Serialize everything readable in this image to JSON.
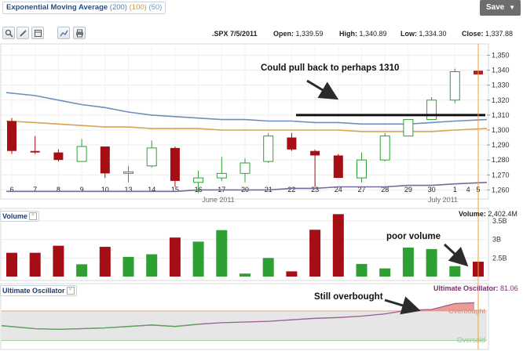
{
  "toolbar": {
    "ema_label": "Exponential Moving Average",
    "ema_periods": [
      "(200)",
      "(100)",
      "(50)"
    ],
    "save_label": "Save"
  },
  "quote": {
    "symbol_date": ".SPX 7/5/2011",
    "open_label": "Open:",
    "open": "1,339.59",
    "high_label": "High:",
    "high": "1,340.89",
    "low_label": "Low:",
    "low": "1,334.30",
    "close_label": "Close:",
    "close": "1,337.88"
  },
  "colors": {
    "up": "#2ea033",
    "down": "#a50e14",
    "ema200": "#6f8fb8",
    "ema100": "#d8a450",
    "ema50": "#7a6a9c",
    "oscillator": "#9c5c92",
    "today_marker": "#f2a23a"
  },
  "volume_panel": {
    "label": "Volume",
    "readout_label": "Volume:",
    "readout_value": "2,402.4M"
  },
  "oscillator_panel": {
    "label": "Ultimate Oscillator",
    "readout_label": "Ultimate Oscillator:",
    "readout_value": "81.06"
  },
  "chart_data": [
    {
      "type": "candlestick",
      "title": "",
      "categories": [
        "6",
        "7",
        "8",
        "9",
        "10",
        "13",
        "14",
        "15",
        "16",
        "17",
        "20",
        "21",
        "22",
        "23",
        "24",
        "27",
        "28",
        "29",
        "30",
        "1",
        "5"
      ],
      "date_labels": [
        "6",
        "7",
        "8",
        "9",
        "10",
        "13",
        "14",
        "15",
        "16",
        "17",
        "20",
        "21",
        "22",
        "23",
        "24",
        "27",
        "28",
        "29",
        "30",
        "1",
        "5"
      ],
      "x_tick_labels": [
        "6",
        "7",
        "8",
        "9",
        "10",
        "13",
        "14",
        "15",
        "16",
        "17",
        "20",
        "21",
        "22",
        "23",
        "24",
        "27",
        "28",
        "29",
        "30",
        "1",
        "4",
        "5"
      ],
      "month_labels": [
        "June 2011",
        "July 2011"
      ],
      "y_ticks": [
        1260,
        1270,
        1280,
        1290,
        1300,
        1310,
        1320,
        1330,
        1340,
        1350
      ],
      "y_tick_labels": [
        "1,260",
        "1,270",
        "1,280",
        "1,290",
        "1,300",
        "1,310",
        "1,320",
        "1,330",
        "1,340",
        "1,350"
      ],
      "ylim": [
        1256,
        1356
      ],
      "grid": true,
      "series": [
        {
          "values": [
            {
              "o": 1306,
              "h": 1308,
              "l": 1284,
              "c": 1286
            },
            {
              "o": 1286,
              "h": 1296,
              "l": 1284,
              "c": 1285
            },
            {
              "o": 1285,
              "h": 1287,
              "l": 1279,
              "c": 1280
            },
            {
              "o": 1279,
              "h": 1294,
              "l": 1279,
              "c": 1289
            },
            {
              "o": 1289,
              "h": 1289,
              "l": 1268,
              "c": 1271
            },
            {
              "o": 1271,
              "h": 1276,
              "l": 1265,
              "c": 1272
            },
            {
              "o": 1276,
              "h": 1293,
              "l": 1275,
              "c": 1288
            },
            {
              "o": 1288,
              "h": 1289,
              "l": 1262,
              "c": 1266
            },
            {
              "o": 1265,
              "h": 1273,
              "l": 1258,
              "c": 1268
            },
            {
              "o": 1268,
              "h": 1282,
              "l": 1266,
              "c": 1271
            },
            {
              "o": 1271,
              "h": 1281,
              "l": 1265,
              "c": 1278
            },
            {
              "o": 1279,
              "h": 1298,
              "l": 1278,
              "c": 1296
            },
            {
              "o": 1295,
              "h": 1298,
              "l": 1286,
              "c": 1287
            },
            {
              "o": 1286,
              "h": 1287,
              "l": 1262,
              "c": 1283
            },
            {
              "o": 1283,
              "h": 1284,
              "l": 1268,
              "c": 1268
            },
            {
              "o": 1268,
              "h": 1285,
              "l": 1265,
              "c": 1280
            },
            {
              "o": 1280,
              "h": 1298,
              "l": 1279,
              "c": 1296
            },
            {
              "o": 1296,
              "h": 1307,
              "l": 1296,
              "c": 1307
            },
            {
              "o": 1307,
              "h": 1322,
              "l": 1307,
              "c": 1320
            },
            {
              "o": 1320,
              "h": 1341,
              "l": 1318,
              "c": 1339
            },
            {
              "o": 1339.59,
              "h": 1340.89,
              "l": 1334.3,
              "c": 1337.88
            }
          ]
        }
      ],
      "moving_averages": [
        {
          "values": [
            1325,
            1323,
            1320,
            1317,
            1315,
            1312,
            1310,
            1309,
            1308,
            1307,
            1307,
            1306,
            1306,
            1305,
            1305,
            1304,
            1304,
            1304,
            1305,
            1306,
            1307
          ]
        },
        {
          "values": [
            1306,
            1305,
            1304,
            1303,
            1302,
            1302,
            1301,
            1301,
            1301,
            1300,
            1300,
            1300,
            1300,
            1300,
            1300,
            1299,
            1299,
            1299,
            1299,
            1300,
            1301
          ]
        },
        {
          "values": [
            1259,
            1259,
            1259,
            1259,
            1259,
            1259,
            1259,
            1259,
            1260,
            1260,
            1260,
            1260,
            1261,
            1261,
            1262,
            1262,
            1262,
            1263,
            1263,
            1264,
            1265
          ]
        }
      ],
      "annotations": [
        {
          "text": "Could pull back to perhaps 1310",
          "level": 1310
        }
      ]
    },
    {
      "type": "bar",
      "title": "Volume",
      "categories": [
        "6",
        "7",
        "8",
        "9",
        "10",
        "13",
        "14",
        "15",
        "16",
        "17",
        "20",
        "21",
        "22",
        "23",
        "24",
        "27",
        "28",
        "29",
        "30",
        "1",
        "5"
      ],
      "values": [
        2.64,
        2.64,
        2.83,
        2.33,
        2.8,
        2.53,
        2.6,
        3.05,
        2.94,
        3.25,
        2.08,
        2.5,
        2.14,
        3.26,
        3.68,
        2.34,
        2.22,
        2.78,
        2.74,
        2.28,
        2.4
      ],
      "direction": [
        "down",
        "down",
        "down",
        "up",
        "down",
        "up",
        "up",
        "down",
        "up",
        "up",
        "up",
        "up",
        "down",
        "down",
        "down",
        "up",
        "up",
        "up",
        "up",
        "up",
        "down"
      ],
      "unit": "B",
      "y_ticks": [
        2.5,
        3.0,
        3.5
      ],
      "y_tick_labels": [
        "2.5B",
        "3B",
        "3.5B"
      ],
      "ylim": [
        2.0,
        3.75
      ],
      "annotations": [
        {
          "text": "poor volume"
        }
      ]
    },
    {
      "type": "line",
      "title": "Ultimate Oscillator",
      "categories": [
        "6",
        "7",
        "8",
        "9",
        "10",
        "13",
        "14",
        "15",
        "16",
        "17",
        "20",
        "21",
        "22",
        "23",
        "24",
        "27",
        "28",
        "29",
        "30",
        "1",
        "5"
      ],
      "values": [
        50,
        46,
        45,
        46,
        47,
        49,
        51,
        49,
        52,
        54,
        55,
        56,
        58,
        60,
        61,
        63,
        66,
        71,
        72,
        80,
        81.06
      ],
      "ylim": [
        20,
        90
      ],
      "bands": {
        "overbought": 70,
        "oversold": 30
      },
      "band_labels": {
        "overbought": "Overbought",
        "oversold": "Oversold"
      },
      "annotations": [
        {
          "text": "Still overbought"
        }
      ]
    }
  ]
}
